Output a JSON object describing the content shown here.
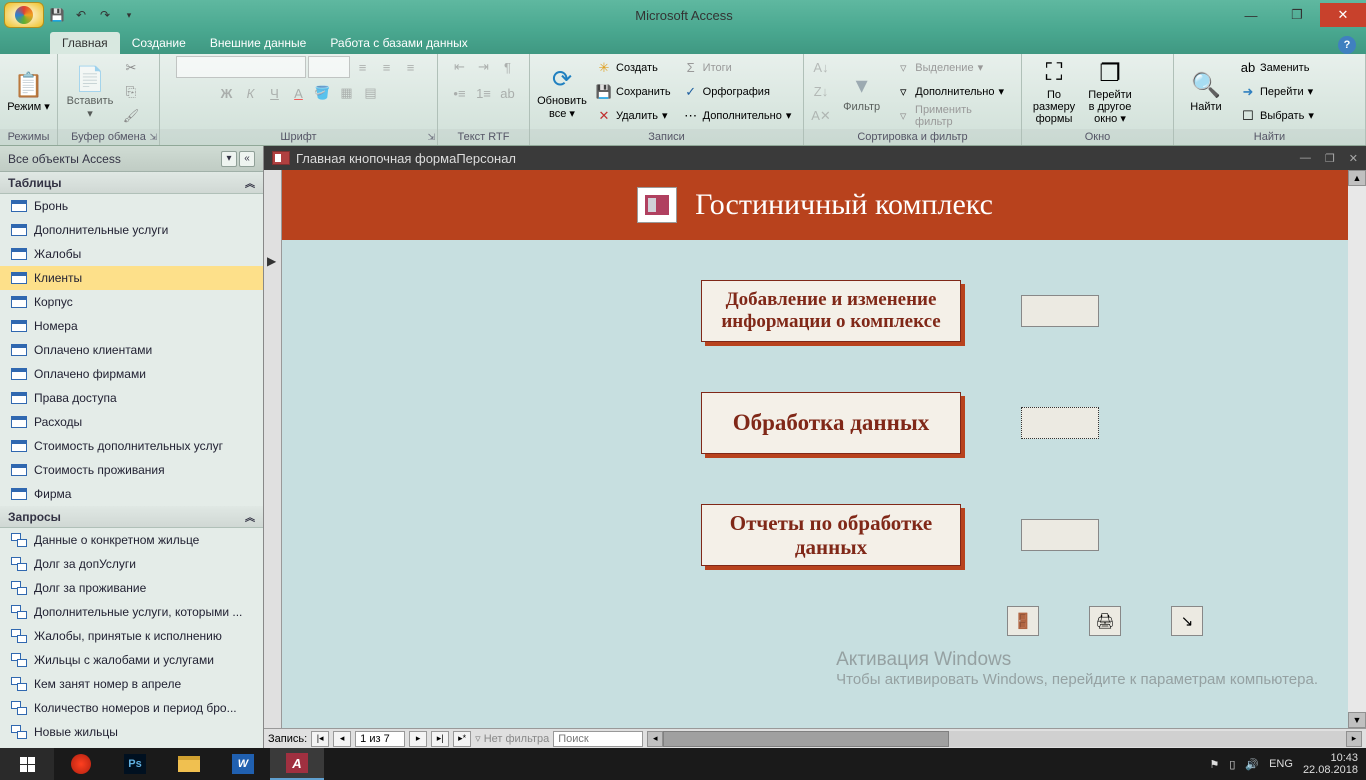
{
  "titlebar": {
    "app_title": "Microsoft Access"
  },
  "tabs": {
    "home": "Главная",
    "create": "Создание",
    "external": "Внешние данные",
    "dbtools": "Работа с базами данных"
  },
  "ribbon": {
    "modes_label": "Режимы",
    "mode_btn": "Режим",
    "clipboard_label": "Буфер обмена",
    "paste_btn": "Вставить",
    "font_label": "Шрифт",
    "rtf_label": "Текст RTF",
    "records_label": "Записи",
    "refresh_btn": "Обновить все",
    "new_btn": "Создать",
    "save_btn": "Сохранить",
    "delete_btn": "Удалить",
    "totals_btn": "Итоги",
    "spelling_btn": "Орфография",
    "more_btn": "Дополнительно",
    "sortfilter_label": "Сортировка и фильтр",
    "filter_btn": "Фильтр",
    "selection_btn": "Выделение",
    "advanced_btn": "Дополнительно",
    "togglefilter_btn": "Применить фильтр",
    "window_label": "Окно",
    "fitform_btn": "По размеру формы",
    "switchwin_btn": "Перейти в другое окно",
    "find_label": "Найти",
    "find_btn": "Найти",
    "replace_btn": "Заменить",
    "goto_btn": "Перейти",
    "select_btn": "Выбрать"
  },
  "nav": {
    "header": "Все объекты Access",
    "tables_section": "Таблицы",
    "tables": [
      "Бронь",
      "Дополнительные услуги",
      "Жалобы",
      "Клиенты",
      "Корпус",
      "Номера",
      "Оплачено клиентами",
      "Оплачено фирмами",
      "Права доступа",
      "Расходы",
      "Стоимость дополнительных услуг",
      "Стоимость проживания",
      "Фирма"
    ],
    "selected_table_index": 3,
    "queries_section": "Запросы",
    "queries": [
      "Данные о конкретном жильце",
      "Долг за допУслуги",
      "Долг за проживание",
      "Дополнительные услуги, которыми ...",
      "Жалобы, принятые к исполнению",
      "Жильцы с жалобами и услугами",
      "Кем занят номер в апреле",
      "Количество номеров и период бро...",
      "Новые жильцы"
    ]
  },
  "form": {
    "title": "Главная кнопочная формаПерсонал",
    "header_title": "Гостиничный комплекс",
    "btn1": "Добавление и изменение информации о комплексе",
    "btn2": "Обработка данных",
    "btn3": "Отчеты по обработке данных"
  },
  "recnav": {
    "label": "Запись:",
    "position": "1 из 7",
    "nofilter": "Нет фильтра",
    "search": "Поиск"
  },
  "watermark": {
    "line1": "Активация Windows",
    "line2": "Чтобы активировать Windows, перейдите к параметрам компьютера."
  },
  "taskbar": {
    "lang": "ENG",
    "time": "10:43",
    "date": "22.08.2018"
  }
}
